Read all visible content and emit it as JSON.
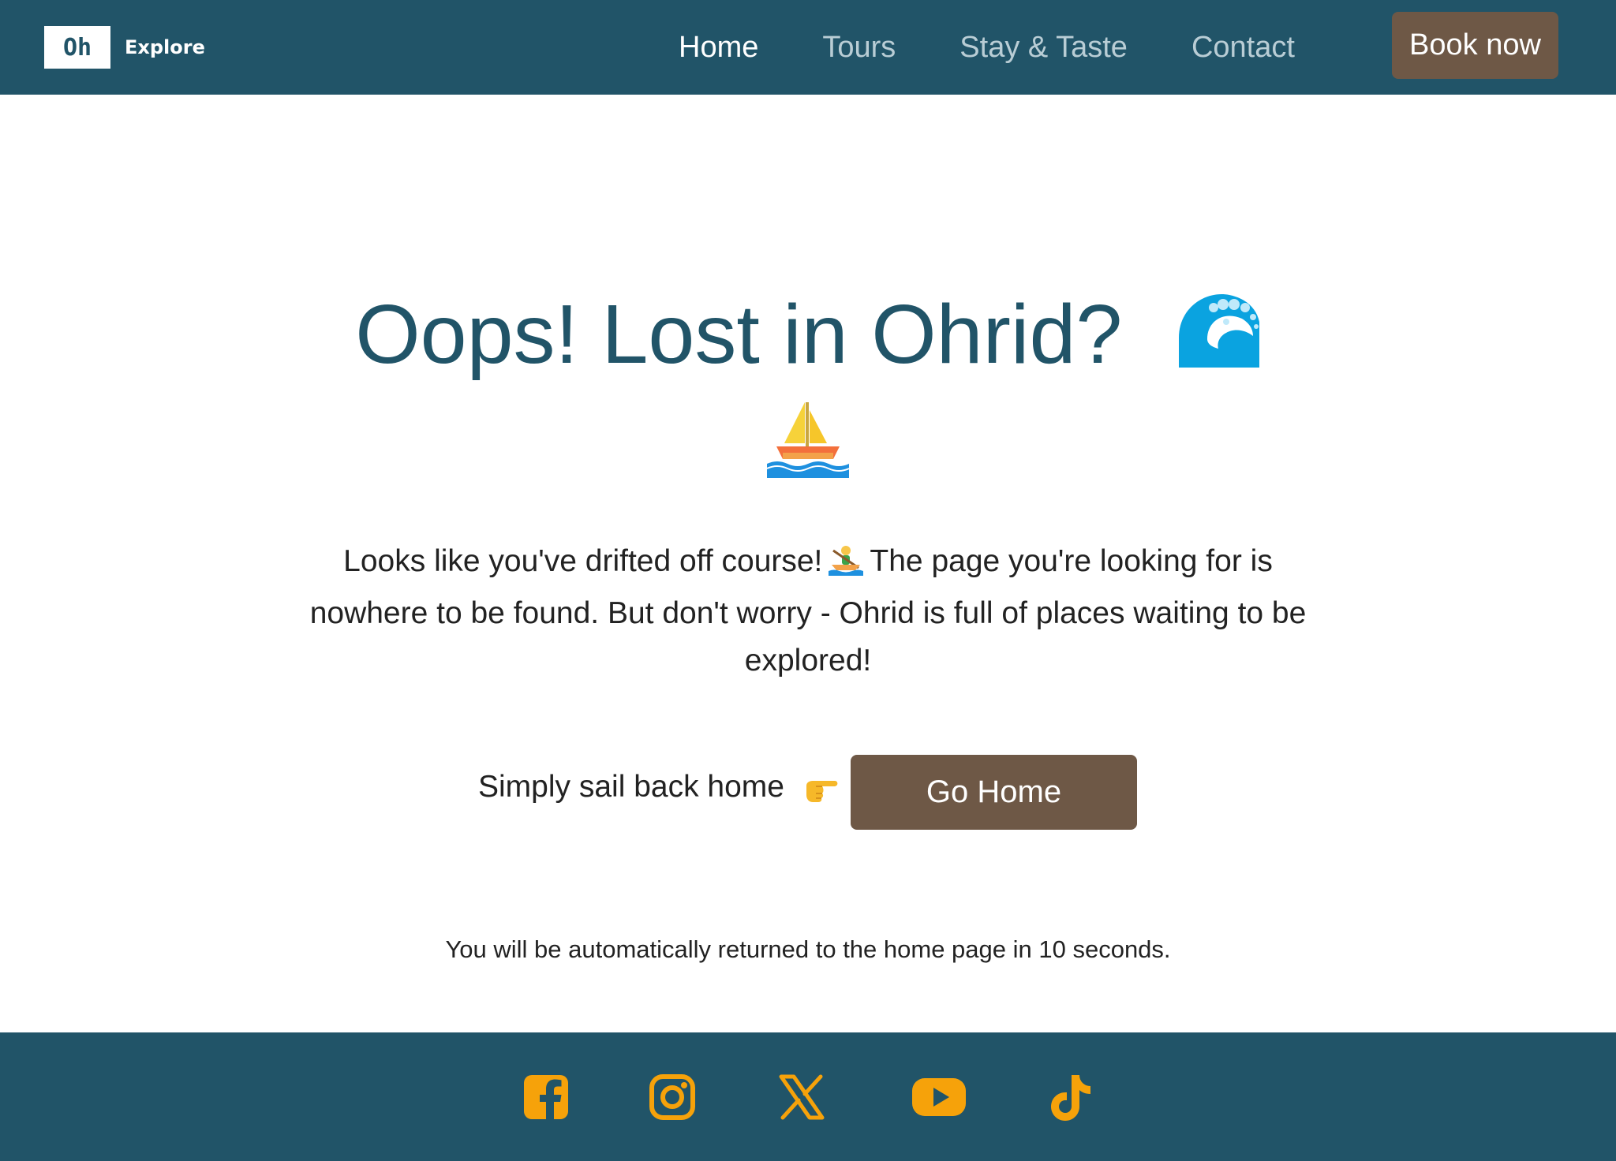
{
  "header": {
    "logo_mark": "Oh",
    "logo_text": "Explore",
    "nav": [
      {
        "label": "Home",
        "active": true
      },
      {
        "label": "Tours",
        "active": false
      },
      {
        "label": "Stay & Taste",
        "active": false
      },
      {
        "label": "Contact",
        "active": false
      }
    ],
    "cta_label": "Book now"
  },
  "main": {
    "headline": "Oops! Lost in Ohrid?",
    "headline_icons": [
      "wave-icon",
      "sailboat-icon"
    ],
    "intro_part1": "Looks like you've drifted off course!",
    "intro_icon": "rowboat-icon",
    "intro_part2": "The page you're looking for is nowhere to be found. But don't worry - Ohrid is full of places waiting to be explored!",
    "sail_text": "Simply sail back home",
    "sail_icon": "pointing-right-icon",
    "go_home_label": "Go Home",
    "redirect_note": "You will be automatically returned to the home page in 10 seconds."
  },
  "footer": {
    "social": [
      "facebook-icon",
      "instagram-icon",
      "x-icon",
      "youtube-icon",
      "tiktok-icon"
    ]
  },
  "colors": {
    "primary": "#215468",
    "button": "#6e5846",
    "nav_inactive": "#b9cdd5",
    "social_icon": "#f6a20a",
    "text": "#222222"
  }
}
